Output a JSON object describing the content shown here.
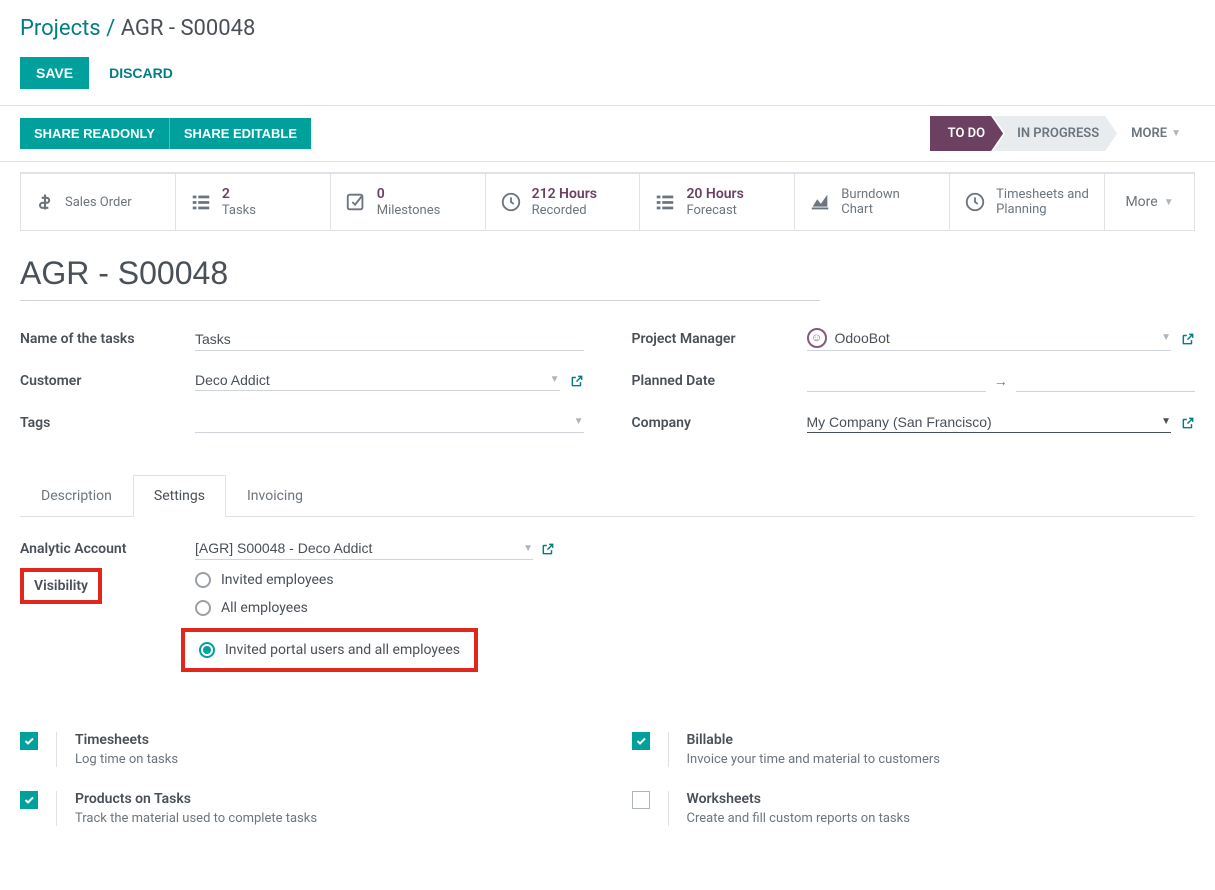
{
  "breadcrumb": {
    "root": "Projects",
    "current": "AGR - S00048"
  },
  "actions": {
    "save": "SAVE",
    "discard": "DISCARD"
  },
  "share": {
    "readonly": "SHARE READONLY",
    "editable": "SHARE EDITABLE"
  },
  "statuses": {
    "todo": "TO DO",
    "in_progress": "IN PROGRESS",
    "more": "MORE"
  },
  "stats": {
    "sales_order": "Sales Order",
    "tasks_count": "2",
    "tasks_label": "Tasks",
    "milestones_count": "0",
    "milestones_label": "Milestones",
    "hours_recorded_count": "212 Hours",
    "hours_recorded_label": "Recorded",
    "hours_forecast_count": "20 Hours",
    "hours_forecast_label": "Forecast",
    "burndown": "Burndown",
    "chart": "Chart",
    "timesheets_and": "Timesheets and",
    "planning": "Planning",
    "more": "More"
  },
  "project_title": "AGR - S00048",
  "fields": {
    "task_name_label": "Name of the tasks",
    "task_name_value": "Tasks",
    "customer_label": "Customer",
    "customer_value": "Deco Addict",
    "tags_label": "Tags",
    "pm_label": "Project Manager",
    "pm_value": "OdooBot",
    "planned_label": "Planned Date",
    "company_label": "Company",
    "company_value": "My Company (San Francisco)"
  },
  "tabs": {
    "description": "Description",
    "settings": "Settings",
    "invoicing": "Invoicing"
  },
  "settings": {
    "analytic_label": "Analytic Account",
    "analytic_value": "[AGR] S00048 - Deco Addict",
    "visibility_label": "Visibility",
    "vis_opt1": "Invited employees",
    "vis_opt2": "All employees",
    "vis_opt3": "Invited portal users and all employees"
  },
  "checkboxes": {
    "timesheets_title": "Timesheets",
    "timesheets_desc": "Log time on tasks",
    "products_title": "Products on Tasks",
    "products_desc": "Track the material used to complete tasks",
    "billable_title": "Billable",
    "billable_desc": "Invoice your time and material to customers",
    "worksheets_title": "Worksheets",
    "worksheets_desc": "Create and fill custom reports on tasks"
  }
}
